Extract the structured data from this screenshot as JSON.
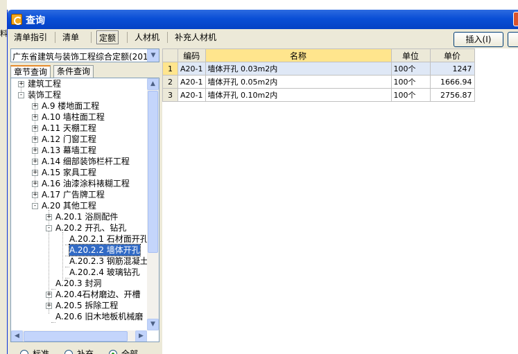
{
  "window": {
    "title": "查询"
  },
  "bg_text": "料",
  "toolbar": {
    "tabs": [
      {
        "label": "清单指引",
        "active": false
      },
      {
        "label": "清单",
        "active": false
      },
      {
        "label": "定额",
        "active": true
      },
      {
        "label": "人材机",
        "active": false
      },
      {
        "label": "补充人材机",
        "active": false
      }
    ],
    "insert_label": "插入(I)"
  },
  "library": {
    "selected": "广东省建筑与装饰工程综合定额(201"
  },
  "search_tabs": [
    {
      "label": "章节查询",
      "active": true
    },
    {
      "label": "条件查询",
      "active": false
    }
  ],
  "tree": {
    "nodes": [
      {
        "label": "建筑工程",
        "expander": "+",
        "selected": false
      },
      {
        "label": "装饰工程",
        "expander": "-",
        "selected": false
      },
      {
        "label": "A.9 楼地面工程",
        "expander": "+",
        "selected": false
      },
      {
        "label": "A.10 墙柱面工程",
        "expander": "+",
        "selected": false
      },
      {
        "label": "A.11 天棚工程",
        "expander": "+",
        "selected": false
      },
      {
        "label": "A.12 门窗工程",
        "expander": "+",
        "selected": false
      },
      {
        "label": "A.13 幕墙工程",
        "expander": "+",
        "selected": false
      },
      {
        "label": "A.14 细部装饰栏杆工程",
        "expander": "+",
        "selected": false
      },
      {
        "label": "A.15 家具工程",
        "expander": "+",
        "selected": false
      },
      {
        "label": "A.16 油漆涂料裱糊工程",
        "expander": "+",
        "selected": false
      },
      {
        "label": "A.17 广告牌工程",
        "expander": "+",
        "selected": false
      },
      {
        "label": "A.20 其他工程",
        "expander": "-",
        "selected": false
      },
      {
        "label": "A.20.1 浴厕配件",
        "expander": "+",
        "selected": false
      },
      {
        "label": "A.20.2 开孔、钻孔",
        "expander": "-",
        "selected": false
      },
      {
        "label": "A.20.2.1 石材面开孔",
        "expander": "",
        "selected": false
      },
      {
        "label": "A.20.2.2 墙体开孔",
        "expander": "",
        "selected": true
      },
      {
        "label": "A.20.2.3 钢筋混凝土",
        "expander": "",
        "selected": false
      },
      {
        "label": "A.20.2.4 玻璃钻孔",
        "expander": "",
        "selected": false
      },
      {
        "label": "A.20.3 封洞",
        "expander": "",
        "selected": false
      },
      {
        "label": "A.20.4石材磨边、开槽",
        "expander": "+",
        "selected": false
      },
      {
        "label": "A.20.5 拆除工程",
        "expander": "+",
        "selected": false
      },
      {
        "label": "A.20.6 旧木地板机械磨",
        "expander": "",
        "selected": false
      }
    ]
  },
  "filter": {
    "options": [
      {
        "label": "标准",
        "checked": false
      },
      {
        "label": "补充",
        "checked": false
      },
      {
        "label": "全部",
        "checked": true
      }
    ]
  },
  "grid": {
    "columns": [
      "编码",
      "名称",
      "单位",
      "单价"
    ],
    "rows": [
      {
        "rownum": "1",
        "code": "A20-1",
        "name": "墙体开孔 0.03m2内",
        "unit": "100个",
        "price": "1247"
      },
      {
        "rownum": "2",
        "code": "A20-1",
        "name": "墙体开孔 0.05m2内",
        "unit": "100个",
        "price": "1666.94"
      },
      {
        "rownum": "3",
        "code": "A20-1",
        "name": "墙体开孔 0.10m2内",
        "unit": "100个",
        "price": "2756.87"
      }
    ]
  }
}
